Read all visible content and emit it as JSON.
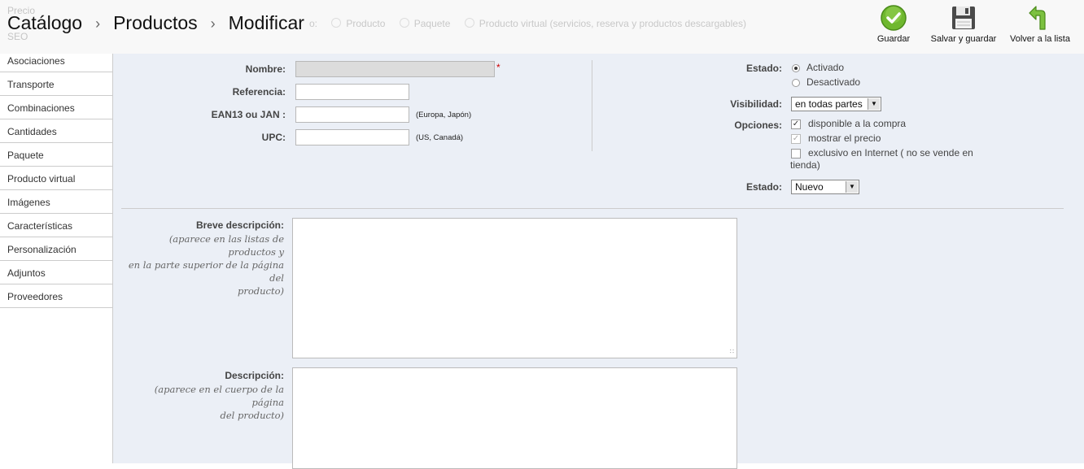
{
  "header": {
    "breadcrumb": [
      "Catálogo",
      "Productos",
      "Modificar"
    ],
    "ghost": {
      "type_label": "o:",
      "opt1": "Producto",
      "opt2": "Paquete",
      "opt3": "Producto virtual (servicios, reserva y productos descargables)",
      "side1": "Precio",
      "side2": "SEO"
    },
    "actions": {
      "save": "Guardar",
      "save_stay": "Salvar y guardar",
      "back": "Volver a la lista"
    }
  },
  "sidebar": {
    "items": [
      "Asociaciones",
      "Transporte",
      "Combinaciones",
      "Cantidades",
      "Paquete",
      "Producto virtual",
      "Imágenes",
      "Características",
      "Personalización",
      "Adjuntos",
      "Proveedores"
    ]
  },
  "form": {
    "name": {
      "label": "Nombre:",
      "value": "",
      "required": "*"
    },
    "reference": {
      "label": "Referencia:",
      "value": ""
    },
    "ean": {
      "label": "EAN13 ou JAN :",
      "value": "",
      "hint": "(Europa, Japón)"
    },
    "upc": {
      "label": "UPC:",
      "value": "",
      "hint": "(US, Canadá)"
    },
    "status": {
      "label": "Estado:",
      "on": "Activado",
      "off": "Desactivado",
      "selected": "Activado"
    },
    "visibility": {
      "label": "Visibilidad:",
      "value": "en todas partes"
    },
    "options": {
      "label": "Opciones:",
      "available": "disponible a la compra",
      "show_price": "mostrar el precio",
      "online_only_1": "exclusivo en Internet ( no se vende en",
      "online_only_2": "tienda)"
    },
    "condition": {
      "label": "Estado:",
      "value": "Nuevo"
    },
    "short_desc": {
      "label": "Breve descripción:",
      "help_1": "(aparece en las listas de productos y",
      "help_2": "en la parte superior de la página del",
      "help_3": "producto)"
    },
    "desc": {
      "label": "Descripción:",
      "help_1": "(aparece en el cuerpo de la página",
      "help_2": "del producto)"
    }
  }
}
